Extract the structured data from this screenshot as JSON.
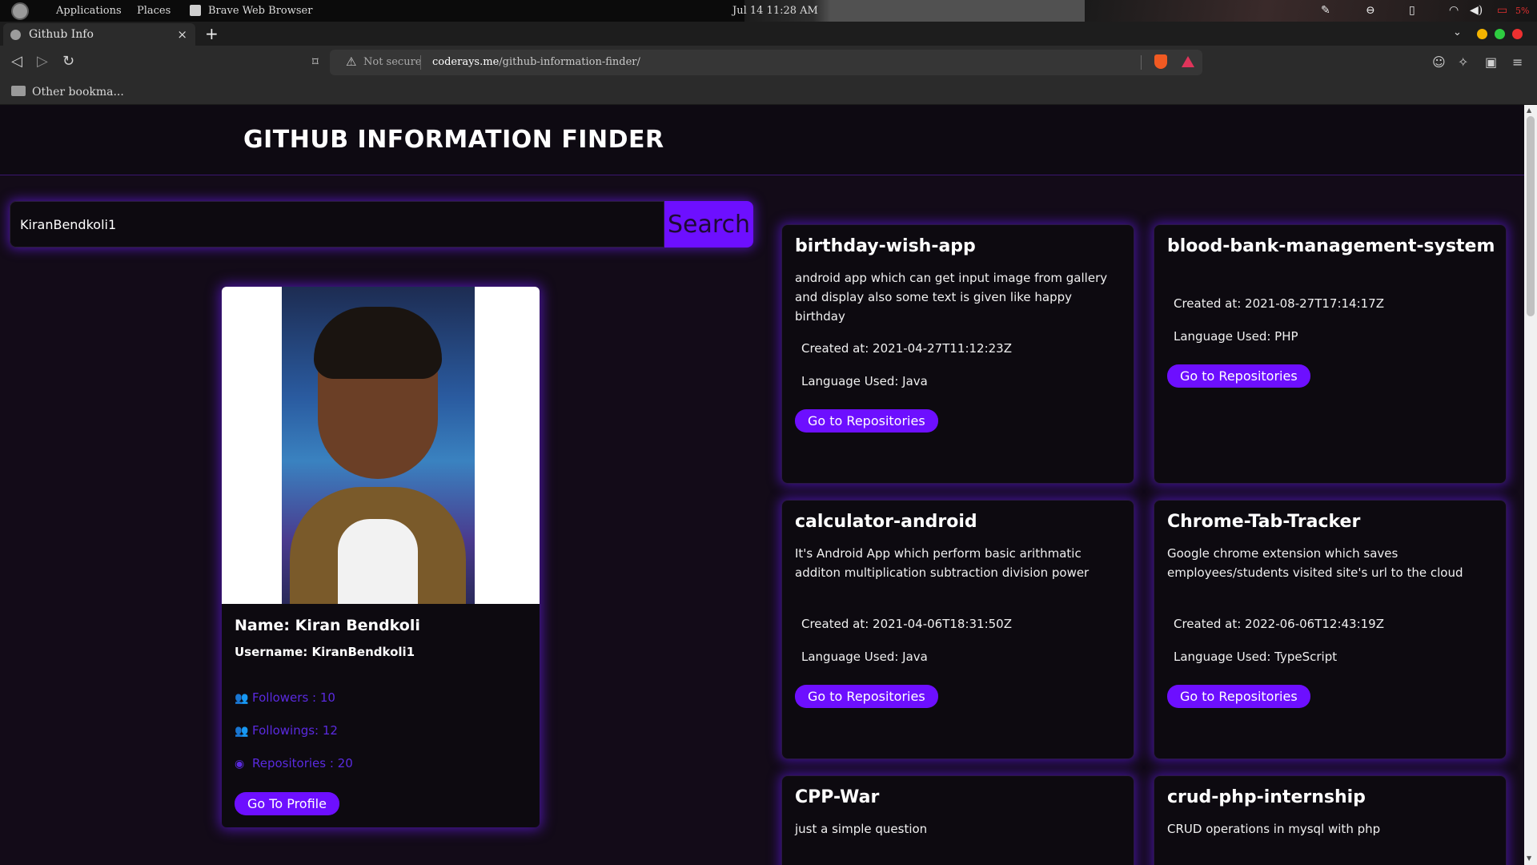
{
  "os": {
    "menu": [
      "Applications",
      "Places",
      "Brave Web Browser"
    ],
    "clock": "Jul 14  11:28 AM",
    "battery": "5%"
  },
  "browser": {
    "tab_title": "Github Info",
    "tab_close": "×",
    "new_tab": "+",
    "url_warning": "Not secure",
    "url_host": "coderays.me",
    "url_path": "/github-information-finder/",
    "bookmark_label": "Other bookma..."
  },
  "site": {
    "title": "GITHUB INFORMATION FINDER",
    "search_value": "KiranBendkoli1",
    "search_button": "Search"
  },
  "profile": {
    "name": "Name: Kiran Bendkoli",
    "username": "Username: KiranBendkoli1",
    "followers": "Followers : 10",
    "followings": "Followings: 12",
    "repositories": "Repositories : 20",
    "profile_button": "Go To Profile"
  },
  "repos": [
    {
      "title": "birthday-wish-app",
      "description": "android app which can get input image from gallery and display also some text is given like happy birthday",
      "created": "Created at: 2021-04-27T11:12:23Z",
      "language": "Language Used: Java",
      "button": "Go to Repositories"
    },
    {
      "title": "blood-bank-management-system",
      "description": "",
      "created": "Created at: 2021-08-27T17:14:17Z",
      "language": "Language Used: PHP",
      "button": "Go to Repositories"
    },
    {
      "title": "calculator-android",
      "description": "It's Android App which perform basic arithmatic additon multiplication subtraction division power",
      "created": "Created at: 2021-04-06T18:31:50Z",
      "language": "Language Used: Java",
      "button": "Go to Repositories"
    },
    {
      "title": "Chrome-Tab-Tracker",
      "description": "Google chrome extension which saves employees/students visited site's url to the cloud",
      "created": "Created at: 2022-06-06T12:43:19Z",
      "language": "Language Used: TypeScript",
      "button": "Go to Repositories"
    },
    {
      "title": "CPP-War",
      "description": "just a simple question"
    },
    {
      "title": "crud-php-internship",
      "description": "CRUD operations in mysql with php"
    }
  ],
  "colors": {
    "accent": "#6d0fff",
    "page_bg": "#130b18",
    "card_bg": "#0d0a10",
    "stat_text": "#5a2ae0"
  }
}
